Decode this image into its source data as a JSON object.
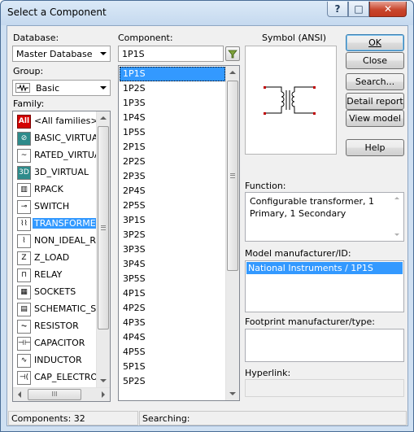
{
  "window": {
    "title": "Select a Component",
    "title_buttons": {
      "help": "?",
      "restore": "□",
      "close": "✕"
    }
  },
  "database": {
    "label": "Database:",
    "value": "Master Database"
  },
  "group": {
    "label": "Group:",
    "value": "Basic",
    "icon": "resistor-group-icon"
  },
  "family": {
    "label": "Family:",
    "items": [
      {
        "label": "<All families>",
        "icon": "all-families-icon",
        "icon_text": "All",
        "selected": false
      },
      {
        "label": "BASIC_VIRTUA",
        "icon": "basic-virtual-icon",
        "icon_text": "⊘",
        "selected": false
      },
      {
        "label": "RATED_VIRTUA",
        "icon": "rated-virtual-icon",
        "icon_text": "~",
        "selected": false
      },
      {
        "label": "3D_VIRTUAL",
        "icon": "3d-virtual-icon",
        "icon_text": "3D",
        "selected": false
      },
      {
        "label": "RPACK",
        "icon": "rpack-icon",
        "icon_text": "▥",
        "selected": false
      },
      {
        "label": "SWITCH",
        "icon": "switch-icon",
        "icon_text": "⊸",
        "selected": false
      },
      {
        "label": "TRANSFORMER",
        "icon": "transformer-icon",
        "icon_text": "⌇⌇",
        "selected": true
      },
      {
        "label": "NON_IDEAL_RL",
        "icon": "non-ideal-rlc-icon",
        "icon_text": "⌇",
        "selected": false
      },
      {
        "label": "Z_LOAD",
        "icon": "z-load-icon",
        "icon_text": "Z",
        "selected": false
      },
      {
        "label": "RELAY",
        "icon": "relay-icon",
        "icon_text": "⊓",
        "selected": false
      },
      {
        "label": "SOCKETS",
        "icon": "sockets-icon",
        "icon_text": "▦",
        "selected": false
      },
      {
        "label": "SCHEMATIC_SY",
        "icon": "schematic-symbol-icon",
        "icon_text": "▤",
        "selected": false
      },
      {
        "label": "RESISTOR",
        "icon": "resistor-icon",
        "icon_text": "⏦",
        "selected": false
      },
      {
        "label": "CAPACITOR",
        "icon": "capacitor-icon",
        "icon_text": "⊣⊢",
        "selected": false
      },
      {
        "label": "INDUCTOR",
        "icon": "inductor-icon",
        "icon_text": "∿",
        "selected": false
      },
      {
        "label": "CAP_ELECTROL",
        "icon": "cap-electrolytic-icon",
        "icon_text": "⊣(",
        "selected": false
      }
    ],
    "hscroll_grip": "III"
  },
  "component": {
    "label": "Component:",
    "search_value": "1P1S",
    "items": [
      "1P1S",
      "1P2S",
      "1P3S",
      "1P4S",
      "1P5S",
      "2P1S",
      "2P2S",
      "2P3S",
      "2P4S",
      "2P5S",
      "3P1S",
      "3P2S",
      "3P3S",
      "3P4S",
      "3P5S",
      "4P1S",
      "4P2S",
      "4P3S",
      "4P4S",
      "4P5S",
      "5P1S",
      "5P2S"
    ],
    "selected_index": 0
  },
  "symbol": {
    "label": "Symbol (ANSI)"
  },
  "buttons": {
    "ok": "OK",
    "close": "Close",
    "search": "Search...",
    "detail_report": "Detail report",
    "view_model": "View model",
    "help": "Help"
  },
  "function": {
    "label": "Function:",
    "text": "Configurable transformer, 1 Primary, 1 Secondary"
  },
  "model_manufacturer": {
    "label": "Model manufacturer/ID:",
    "selected": "National Instruments / 1P1S"
  },
  "footprint": {
    "label": "Footprint manufacturer/type:"
  },
  "hyperlink": {
    "label": "Hyperlink:"
  },
  "status": {
    "components_label": "Components: 32",
    "searching_label": "Searching:"
  },
  "colors": {
    "selection": "#3399ff",
    "title_bg": "#cfe0f2",
    "close_red": "#c8462d",
    "all_families_red": "#d40000",
    "icon_teal": "#2e8b8b"
  }
}
